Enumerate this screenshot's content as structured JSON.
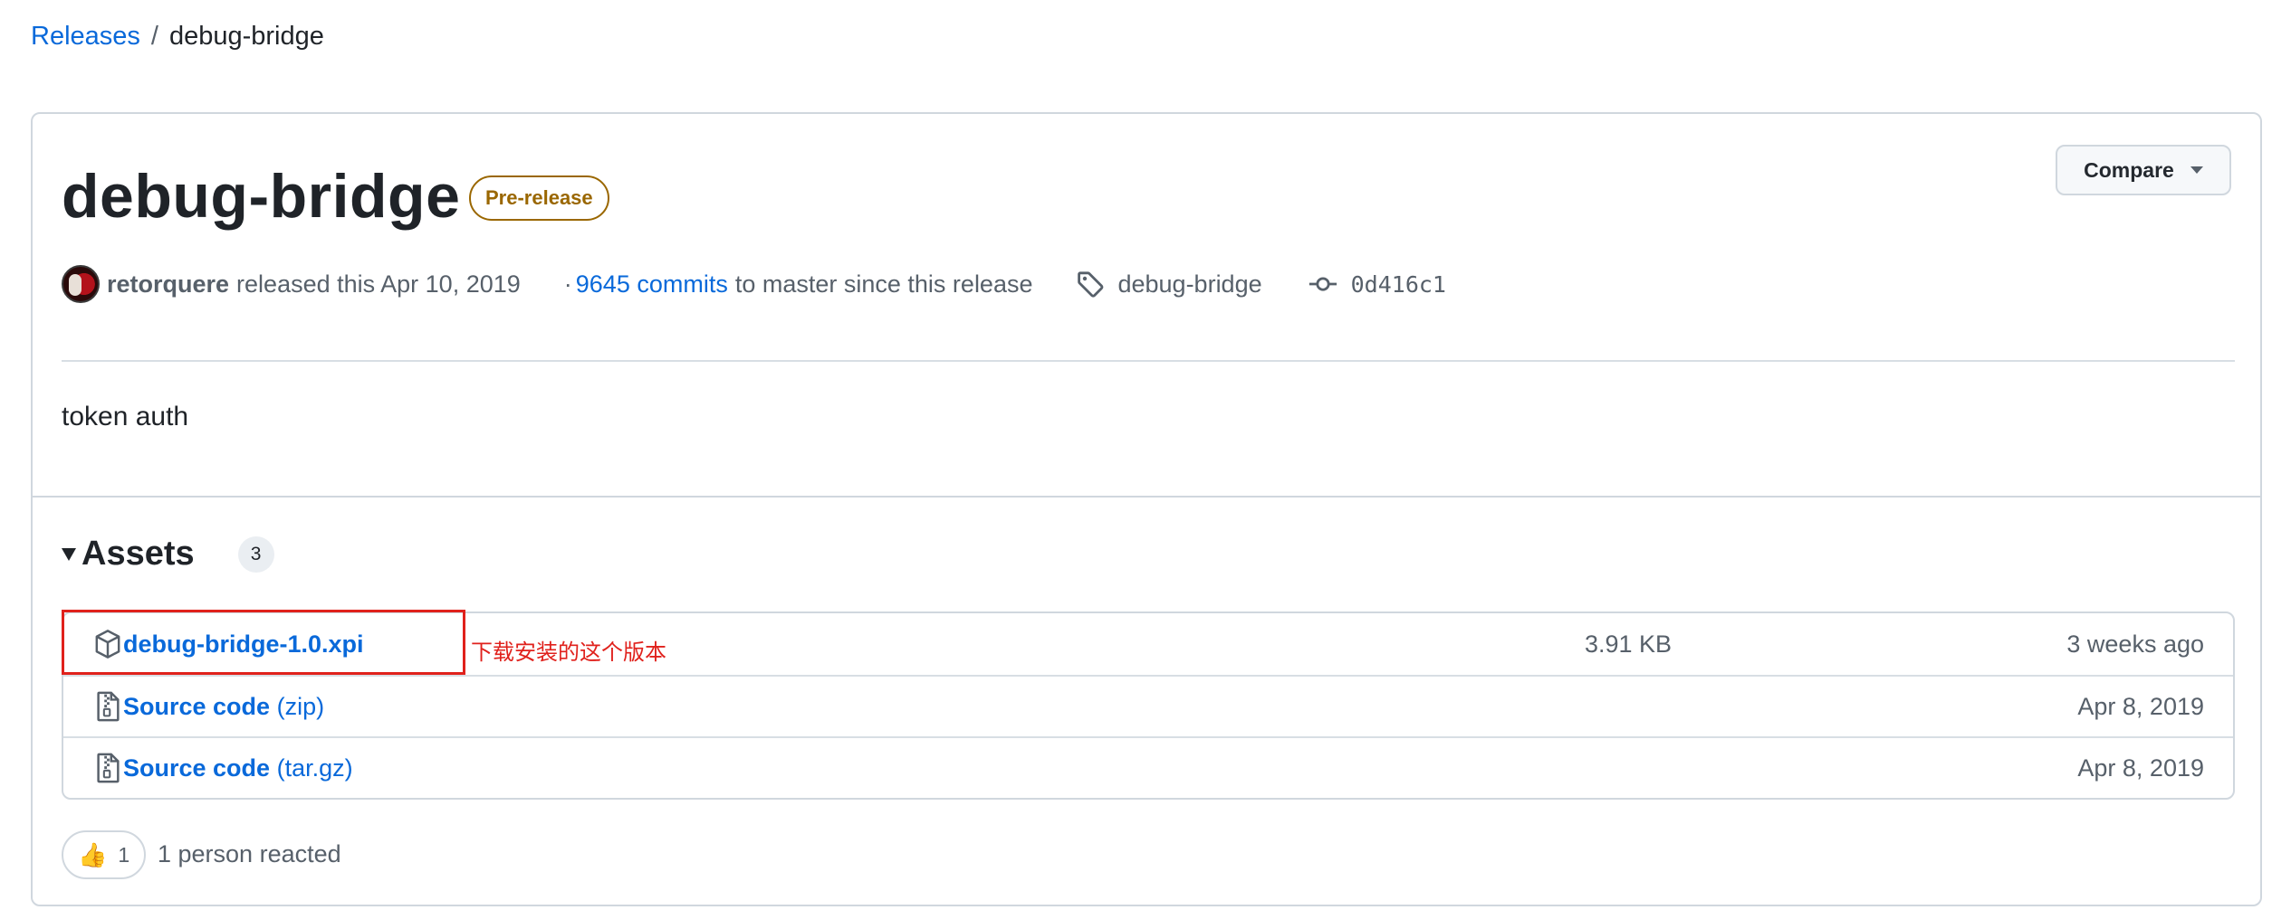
{
  "breadcrumb": {
    "parent": "Releases",
    "separator": "/",
    "current": "debug-bridge"
  },
  "release": {
    "title": "debug-bridge",
    "badge": "Pre-release",
    "compare_label": "Compare",
    "author": "retorquere",
    "released_text": "released this Apr 10, 2019",
    "dot": "·",
    "commits_link": "9645 commits",
    "commits_suffix": "to master since this release",
    "tag": "debug-bridge",
    "commit_sha": "0d416c1",
    "body": "token auth"
  },
  "assets": {
    "title": "Assets",
    "count": "3",
    "items": [
      {
        "name": "debug-bridge-1.0.xpi",
        "suffix": "",
        "size": "3.91 KB",
        "date": "3 weeks ago",
        "icon": "package-icon"
      },
      {
        "name": "Source code",
        "suffix": "(zip)",
        "size": "",
        "date": "Apr 8, 2019",
        "icon": "file-zip-icon"
      },
      {
        "name": "Source code",
        "suffix": "(tar.gz)",
        "size": "",
        "date": "Apr 8, 2019",
        "icon": "file-zip-icon"
      }
    ],
    "annotation_note": "下载安装的这个版本"
  },
  "reactions": {
    "emoji": "👍",
    "count": "1",
    "summary": "1 person reacted"
  },
  "colors": {
    "link": "#0969da",
    "badge": "#9a6700",
    "annotation": "#e0211c",
    "border": "#d0d7de"
  }
}
